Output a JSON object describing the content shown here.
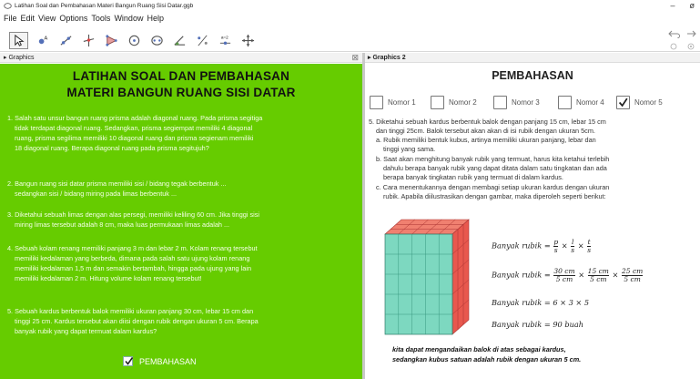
{
  "window": {
    "title": "Latihan Soal dan Pembahasan Materi Bangun Ruang Sisi Datar.ggb",
    "minimize": "–",
    "maximize": "ø"
  },
  "menu": [
    "File",
    "Edit",
    "View",
    "Options",
    "Tools",
    "Window",
    "Help"
  ],
  "toolbar": {
    "tools": [
      "move-tool",
      "point-tool",
      "line-tool",
      "perpendicular-tool",
      "polygon-tool",
      "circle-tool",
      "conic-tool",
      "angle-tool",
      "reflect-tool",
      "slider-tool",
      "move-view-tool"
    ],
    "slider_label": "a=2"
  },
  "left_panel": {
    "header": "Graphics",
    "title1": "LATIHAN SOAL DAN PEMBAHASAN",
    "title2": "MATERI BANGUN RUANG SISI DATAR",
    "questions": [
      {
        "l1": "1. Salah satu unsur bangun ruang prisma adalah diagonal ruang. Pada prisma segitiga",
        "l2": "tidak terdapat diagonal ruang. Sedangkan, prisma segiempat memiliki 4 diagonal",
        "l3": "ruang, prisma segilima memiliki 10 diagonal ruang dan prisma segienam memiliki",
        "l4": "18 diagonal ruang. Berapa diagonal ruang pada prisma segitujuh?"
      },
      {
        "l1": "2. Bangun ruang sisi datar prisma memiliki sisi / bidang tegak berbentuk ...",
        "l2": "sedangkan sisi / bidang miring pada limas berbentuk ...",
        "l3": "",
        "l4": ""
      },
      {
        "l1": "3. Diketahui sebuah limas dengan alas persegi, memiliki keliling 60 cm. Jika tinggi sisi",
        "l2": "miring limas tersebut adalah 8 cm, maka luas permukaan limas adalah ...",
        "l3": "",
        "l4": ""
      },
      {
        "l1": "4. Sebuah kolam renang memiliki panjang 3 m dan lebar 2 m. Kolam renang tersebut",
        "l2": "memiliki kedalaman yang berbeda, dimana pada salah satu ujung kolam renang",
        "l3": "memiliki kedalaman 1,5 m dan semakin bertambah, hingga pada ujung yang lain",
        "l4": "memiliki kedalaman 2 m. Hitung volume kolam renang tersebut!"
      },
      {
        "l1": "5. Sebuah kardus berbentuk balok memiliki ukuran panjang 30 cm, lebar 15 cm dan",
        "l2": "tinggi 25 cm. Kardus tersebut akan diisi dengan rubik dengan ukuran 5 cm. Berapa",
        "l3": "banyak rubik yang dapat termuat dalam kardus?",
        "l4": ""
      }
    ],
    "checkbox_label": "PEMBAHASAN"
  },
  "right_panel": {
    "header": "Graphics 2",
    "title": "PEMBAHASAN",
    "tabs": [
      {
        "label": "Nomor 1",
        "checked": false
      },
      {
        "label": "Nomor 2",
        "checked": false
      },
      {
        "label": "Nomor 3",
        "checked": false
      },
      {
        "label": "Nomor 4",
        "checked": false
      },
      {
        "label": "Nomor 5",
        "checked": true
      }
    ],
    "lines": [
      "5. Diketahui sebuah kardus berbentuk balok dengan  panjang 15 cm, lebar 15 cm",
      "dan tinggi 25cm. Balok tersebut akan akan di isi rubik dengan ukuran 5cm.",
      "a. Rubik memiliki bentuk kubus, artinya memiliki ukuran panjang, lebar dan",
      "tinggi yang sama.",
      "b. Saat akan menghitung banyak rubik yang termuat, harus kita ketahui terlebih",
      "dahulu berapa banyak rubik yang dapat ditata dalam satu tingkatan dan ada",
      "berapa banyak tingkatan rubik yang termuat di dalam kardus.",
      "c. Cara menentukannya dengan membagi setiap ukuran kardus dengan ukuran",
      "rubik. Apabila diilustrasikan dengan gambar, maka diperoleh seperti berikut:"
    ],
    "formula": {
      "lhs": "Banyak rubik =",
      "f1": {
        "p": "p",
        "s": "s",
        "l": "l",
        "t": "t"
      },
      "f2": {
        "a": "30 cm",
        "b": "15 cm",
        "c": "25 cm",
        "d": "5 cm"
      },
      "f3": "Banyak rubik = 6 × 3 × 5",
      "f4": "Banyak rubik = 90 buah",
      "times": "×"
    },
    "note1": "kita dapat mengandaikan balok di atas sebagai kardus,",
    "note2": "sedangkan kubus satuan adalah rubik dengan ukuran 5 cm."
  },
  "colors": {
    "left_bg": "#66cc00",
    "cube_face": "#7dd8c0",
    "cube_side": "#e8584e",
    "cube_top": "#f08070"
  }
}
